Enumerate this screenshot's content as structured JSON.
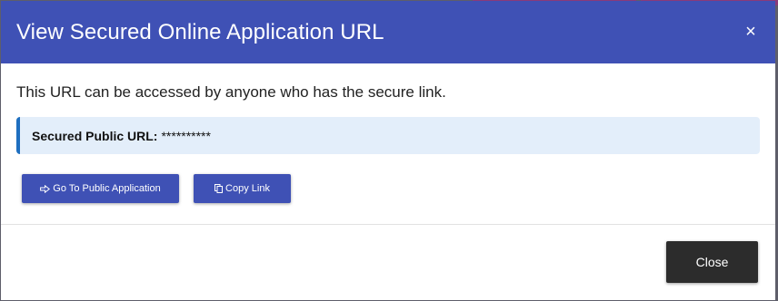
{
  "dialog": {
    "title": "View Secured Online Application URL",
    "close_symbol": "×",
    "description": "This URL can be accessed by anyone who has the secure link.",
    "url_label": "Secured Public URL:",
    "url_value": "**********",
    "buttons": {
      "public_label": "Go To Public Application",
      "public_icon": "arrow-right-outline-icon",
      "copy_label": "Copy Link",
      "copy_icon": "copy-icon"
    },
    "footer": {
      "close_label": "Close"
    }
  },
  "colors": {
    "header": "#3f51b5",
    "button": "#3f51b5",
    "info_bg": "#e3eefa",
    "info_border": "#1e6fc0",
    "close_button": "#2c2c2c"
  }
}
